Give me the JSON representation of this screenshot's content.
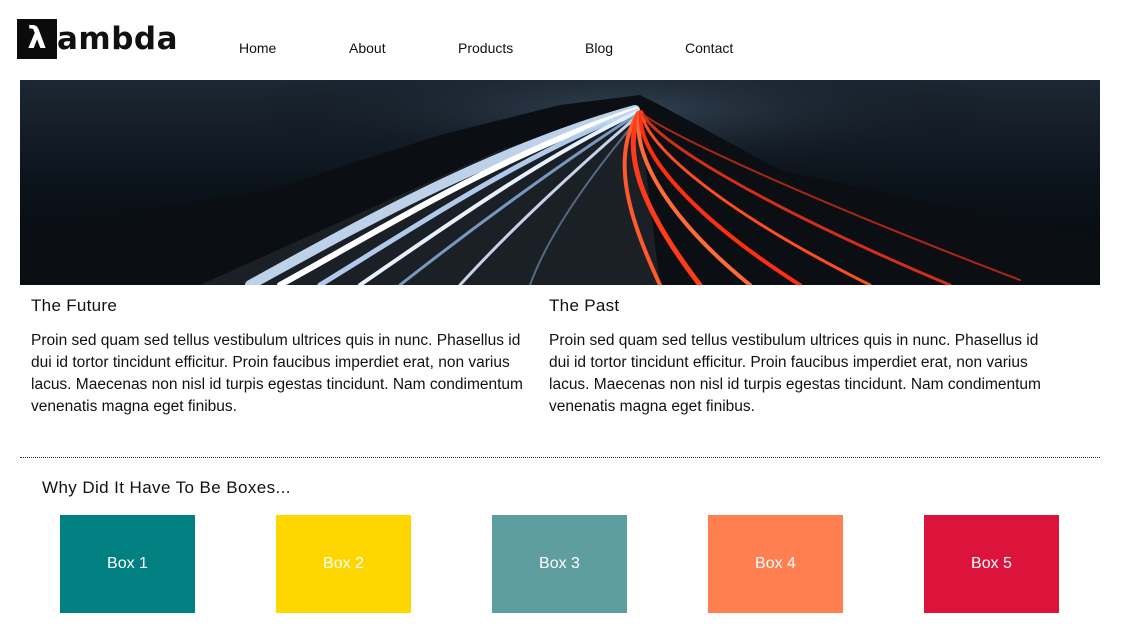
{
  "brand": {
    "logo_mark": "λ",
    "logo_text": "ambda"
  },
  "nav": {
    "items": [
      "Home",
      "About",
      "Products",
      "Blog",
      "Contact"
    ]
  },
  "content": {
    "left": {
      "title": "The Future",
      "body": "Proin sed quam sed tellus vestibulum ultrices quis in nunc. Phasellus id dui id tortor tincidunt efficitur. Proin faucibus imperdiet erat, non varius lacus. Maecenas non nisl id turpis egestas tincidunt. Nam condimentum venenatis magna eget finibus."
    },
    "right": {
      "title": "The Past",
      "body": "Proin sed quam sed tellus vestibulum ultrices quis in nunc. Phasellus id dui id tortor tincidunt efficitur. Proin faucibus imperdiet erat, non varius lacus. Maecenas non nisl id turpis egestas tincidunt. Nam condimentum venenatis magna eget finibus."
    }
  },
  "boxes_section": {
    "title": "Why Did It Have To Be Boxes...",
    "boxes": [
      {
        "label": "Box 1",
        "color": "#008080"
      },
      {
        "label": "Box 2",
        "color": "#FFD700"
      },
      {
        "label": "Box 3",
        "color": "#5F9EA0"
      },
      {
        "label": "Box 4",
        "color": "#FF7F50"
      },
      {
        "label": "Box 5",
        "color": "#DC143C"
      }
    ]
  }
}
